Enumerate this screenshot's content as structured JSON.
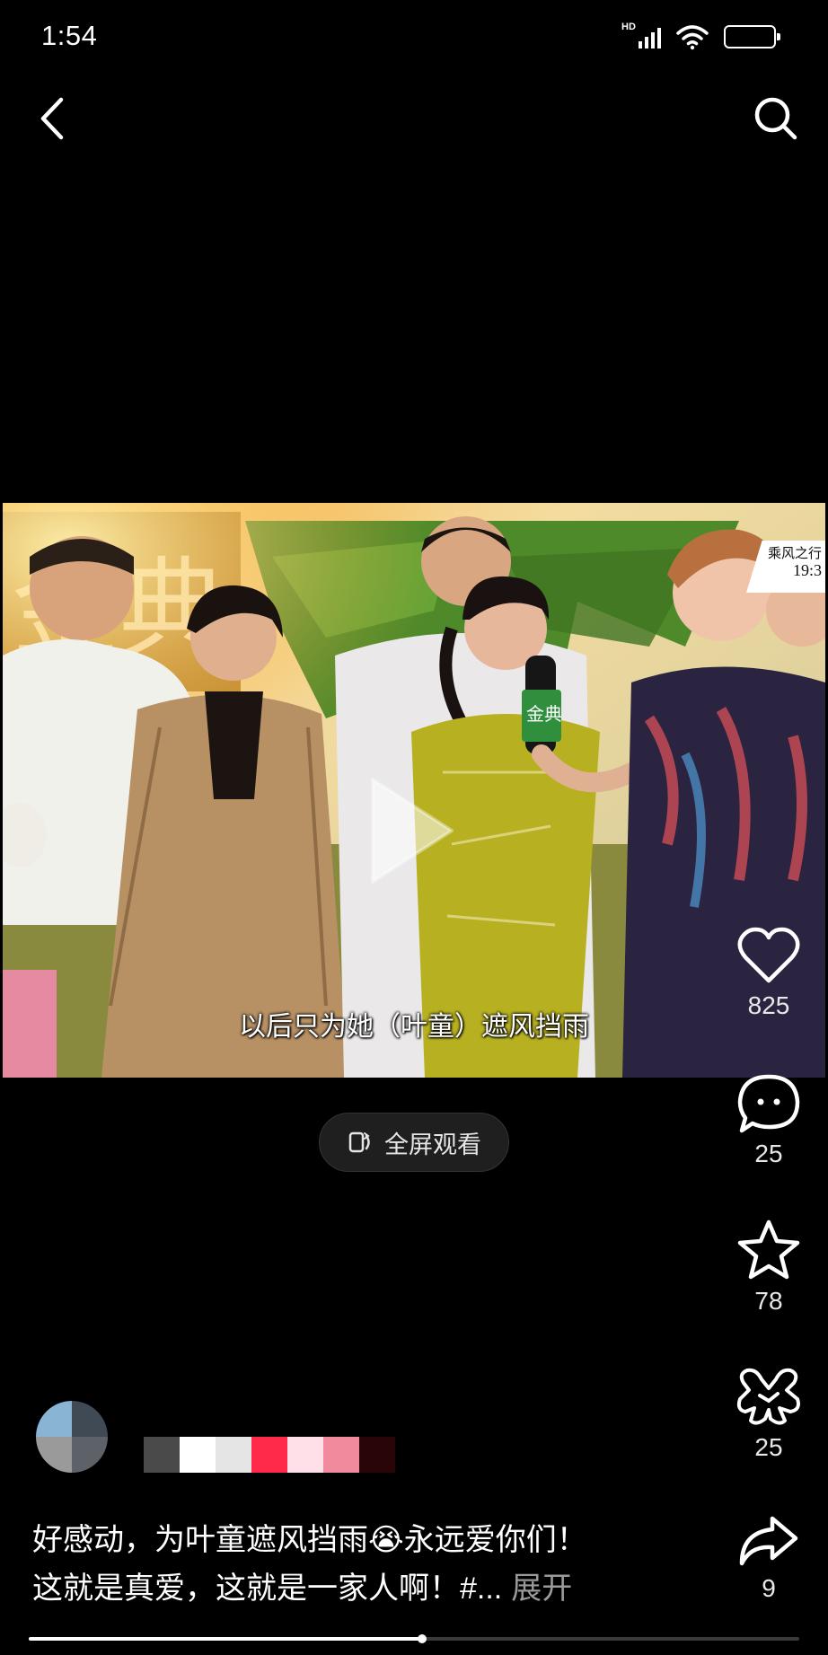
{
  "status_bar": {
    "time": "1:54",
    "network_label": "HD",
    "signal_icon": "cellular-signal-icon",
    "wifi_icon": "wifi-icon",
    "battery_icon": "battery-icon"
  },
  "nav": {
    "back_icon": "back-chevron-icon",
    "search_icon": "search-icon"
  },
  "video": {
    "subtitle": "以后只为她（叶童）遮风挡雨",
    "station_badge_line1": "乘风之行",
    "station_badge_line2": "19:3",
    "billboard_brand": "金典",
    "mic_brand": "金典",
    "play_icon": "play-icon"
  },
  "fullscreen_button": {
    "label": "全屏观看",
    "icon": "rotate-screen-icon"
  },
  "actions": {
    "like": {
      "icon": "heart-icon",
      "count": "825"
    },
    "comment": {
      "icon": "comment-icon",
      "count": "25"
    },
    "favorite": {
      "icon": "star-icon",
      "count": "78"
    },
    "gift": {
      "icon": "gift-ribbon-icon",
      "count": "25"
    },
    "share": {
      "icon": "share-arrow-icon",
      "count": "9"
    }
  },
  "author": {
    "avatar_colors": [
      "#8ab4d4",
      "#3f4a55",
      "#9a9a9a",
      "#5d6268"
    ],
    "name_blocks": [
      "#4a4a4a",
      "#ffffff",
      "#e5e5e5",
      "#ff2a4a",
      "#ffe0e8",
      "#f08a9c",
      "#2a0508"
    ]
  },
  "caption": {
    "line1": "好感动，为叶童遮风挡雨😭永远爱你们！",
    "line2": "这就是真爱，这就是一家人啊！#...",
    "expand_label": "展开"
  },
  "progress": {
    "fraction": 0.51
  },
  "colors": {
    "background": "#000000",
    "accent_red": "#ff2a4a",
    "muted_text": "#9a9a9a"
  }
}
